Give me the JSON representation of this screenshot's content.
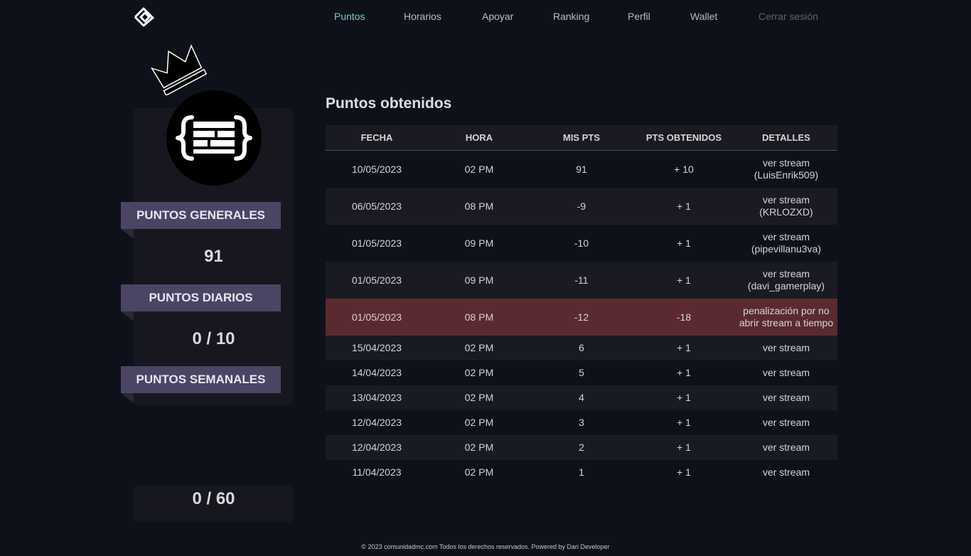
{
  "nav": {
    "items": [
      {
        "label": "Puntos",
        "state": "active"
      },
      {
        "label": "Horarios",
        "state": "normal"
      },
      {
        "label": "Apoyar",
        "state": "normal"
      },
      {
        "label": "Ranking",
        "state": "normal"
      },
      {
        "label": "Perfil",
        "state": "normal"
      },
      {
        "label": "Wallet",
        "state": "normal"
      },
      {
        "label": "Cerrar sesión",
        "state": "muted"
      }
    ]
  },
  "profile": {
    "icon": "code-brackets-icon",
    "badge_icon": "crown-icon"
  },
  "stats": {
    "general_label": "PUNTOS GENERALES",
    "general_value": "91",
    "daily_label": "PUNTOS DIARIOS",
    "daily_value": "0 / 10",
    "weekly_label": "PUNTOS SEMANALES",
    "weekly_value": "0 / 60"
  },
  "main": {
    "title": "Puntos obtenidos",
    "table": {
      "headers": [
        "FECHA",
        "HORA",
        "MIS PTS",
        "PTS OBTENIDOS",
        "DETALLES"
      ],
      "rows": [
        {
          "fecha": "10/05/2023",
          "hora": "02 PM",
          "mis_pts": "91",
          "obtenidos": "+ 10",
          "detalles": [
            "ver stream",
            "(LuisEnrik509)"
          ],
          "penalty": false
        },
        {
          "fecha": "06/05/2023",
          "hora": "08 PM",
          "mis_pts": "-9",
          "obtenidos": "+ 1",
          "detalles": [
            "ver stream",
            "(KRLOZXD)"
          ],
          "penalty": false
        },
        {
          "fecha": "01/05/2023",
          "hora": "09 PM",
          "mis_pts": "-10",
          "obtenidos": "+ 1",
          "detalles": [
            "ver stream",
            "(pipevillanu3va)"
          ],
          "penalty": false
        },
        {
          "fecha": "01/05/2023",
          "hora": "09 PM",
          "mis_pts": "-11",
          "obtenidos": "+ 1",
          "detalles": [
            "ver stream",
            "(davi_gamerplay)"
          ],
          "penalty": false
        },
        {
          "fecha": "01/05/2023",
          "hora": "08 PM",
          "mis_pts": "-12",
          "obtenidos": "-18",
          "detalles": [
            "penalización por no",
            "abrir stream a tiempo"
          ],
          "penalty": true
        },
        {
          "fecha": "15/04/2023",
          "hora": "02 PM",
          "mis_pts": "6",
          "obtenidos": "+ 1",
          "detalles": [
            "ver stream"
          ],
          "penalty": false
        },
        {
          "fecha": "14/04/2023",
          "hora": "02 PM",
          "mis_pts": "5",
          "obtenidos": "+ 1",
          "detalles": [
            "ver stream"
          ],
          "penalty": false
        },
        {
          "fecha": "13/04/2023",
          "hora": "02 PM",
          "mis_pts": "4",
          "obtenidos": "+ 1",
          "detalles": [
            "ver stream"
          ],
          "penalty": false
        },
        {
          "fecha": "12/04/2023",
          "hora": "02 PM",
          "mis_pts": "3",
          "obtenidos": "+ 1",
          "detalles": [
            "ver stream"
          ],
          "penalty": false
        },
        {
          "fecha": "12/04/2023",
          "hora": "02 PM",
          "mis_pts": "2",
          "obtenidos": "+ 1",
          "detalles": [
            "ver stream"
          ],
          "penalty": false
        },
        {
          "fecha": "11/04/2023",
          "hora": "02 PM",
          "mis_pts": "1",
          "obtenidos": "+ 1",
          "detalles": [
            "ver stream"
          ],
          "penalty": false
        }
      ]
    }
  },
  "footer": {
    "text": "© 2023 comunidadmc.com Todos los derechos reservados. Powered by Dari Developer"
  },
  "colors": {
    "background": "#0f111a",
    "active_nav": "#7ec7c2",
    "ribbon": "#4b4563",
    "penalty_row": "#5a2a30"
  }
}
